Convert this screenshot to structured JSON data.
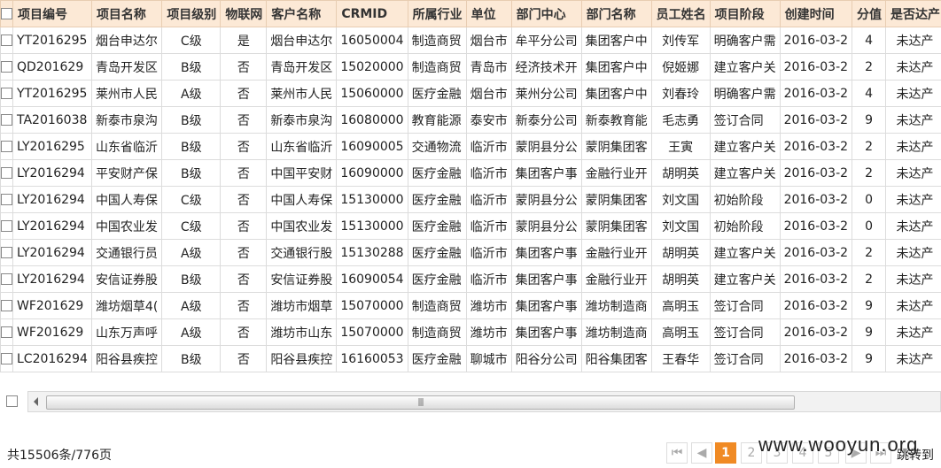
{
  "table": {
    "columns": [
      "项目编号",
      "项目名称",
      "项目级别",
      "物联网",
      "客户名称",
      "CRMID",
      "所属行业",
      "单位",
      "部门中心",
      "部门名称",
      "员工姓名",
      "项目阶段",
      "创建时间",
      "分值",
      "是否达产"
    ],
    "rows": [
      [
        "YT2016295",
        "烟台申达尔",
        "C级",
        "是",
        "烟台申达尔",
        "16050004",
        "制造商贸",
        "烟台市",
        "牟平分公司",
        "集团客户中",
        "刘传军",
        "明确客户需",
        "2016-03-2",
        "4",
        "未达产"
      ],
      [
        "QD201629",
        "青岛开发区",
        "B级",
        "否",
        "青岛开发区",
        "15020000",
        "制造商贸",
        "青岛市",
        "经济技术开",
        "集团客户中",
        "倪姬娜",
        "建立客户关",
        "2016-03-2",
        "2",
        "未达产"
      ],
      [
        "YT2016295",
        "莱州市人民",
        "A级",
        "否",
        "莱州市人民",
        "15060000",
        "医疗金融",
        "烟台市",
        "莱州分公司",
        "集团客户中",
        "刘春玲",
        "明确客户需",
        "2016-03-2",
        "4",
        "未达产"
      ],
      [
        "TA2016038",
        "新泰市泉沟",
        "B级",
        "否",
        "新泰市泉沟",
        "16080000",
        "教育能源",
        "泰安市",
        "新泰分公司",
        "新泰教育能",
        "毛志勇",
        "签订合同",
        "2016-03-2",
        "9",
        "未达产"
      ],
      [
        "LY2016295",
        "山东省临沂",
        "B级",
        "否",
        "山东省临沂",
        "16090005",
        "交通物流",
        "临沂市",
        "蒙阴县分公",
        "蒙阴集团客",
        "王寅",
        "建立客户关",
        "2016-03-2",
        "2",
        "未达产"
      ],
      [
        "LY2016294",
        "平安财产保",
        "B级",
        "否",
        "中国平安财",
        "16090000",
        "医疗金融",
        "临沂市",
        "集团客户事",
        "金融行业开",
        "胡明英",
        "建立客户关",
        "2016-03-2",
        "2",
        "未达产"
      ],
      [
        "LY2016294",
        "中国人寿保",
        "C级",
        "否",
        "中国人寿保",
        "15130000",
        "医疗金融",
        "临沂市",
        "蒙阴县分公",
        "蒙阴集团客",
        "刘文国",
        "初始阶段",
        "2016-03-2",
        "0",
        "未达产"
      ],
      [
        "LY2016294",
        "中国农业发",
        "C级",
        "否",
        "中国农业发",
        "15130000",
        "医疗金融",
        "临沂市",
        "蒙阴县分公",
        "蒙阴集团客",
        "刘文国",
        "初始阶段",
        "2016-03-2",
        "0",
        "未达产"
      ],
      [
        "LY2016294",
        "交通银行员",
        "A级",
        "否",
        "交通银行股",
        "15130288",
        "医疗金融",
        "临沂市",
        "集团客户事",
        "金融行业开",
        "胡明英",
        "建立客户关",
        "2016-03-2",
        "2",
        "未达产"
      ],
      [
        "LY2016294",
        "安信证券股",
        "B级",
        "否",
        "安信证券股",
        "16090054",
        "医疗金融",
        "临沂市",
        "集团客户事",
        "金融行业开",
        "胡明英",
        "建立客户关",
        "2016-03-2",
        "2",
        "未达产"
      ],
      [
        "WF201629",
        "潍坊烟草4(",
        "A级",
        "否",
        "潍坊市烟草",
        "15070000",
        "制造商贸",
        "潍坊市",
        "集团客户事",
        "潍坊制造商",
        "高明玉",
        "签订合同",
        "2016-03-2",
        "9",
        "未达产"
      ],
      [
        "WF201629",
        "山东万声呼",
        "A级",
        "否",
        "潍坊市山东",
        "15070000",
        "制造商贸",
        "潍坊市",
        "集团客户事",
        "潍坊制造商",
        "高明玉",
        "签订合同",
        "2016-03-2",
        "9",
        "未达产"
      ],
      [
        "LC2016294",
        "阳谷县疾控",
        "B级",
        "否",
        "阳谷县疾控",
        "16160053",
        "医疗金融",
        "聊城市",
        "阳谷分公司",
        "阳谷集团客",
        "王春华",
        "签订合同",
        "2016-03-2",
        "9",
        "未达产"
      ]
    ]
  },
  "footer": {
    "total_text": "共15506条/776页",
    "pages": [
      "1",
      "2",
      "3",
      "4",
      "5"
    ],
    "current_page": "1",
    "jump_label": "跳转到"
  },
  "watermark": "www.wooyun.org"
}
